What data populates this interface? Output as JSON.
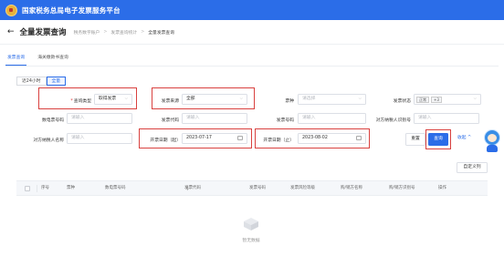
{
  "app": {
    "title": "国家税务总局电子发票服务平台"
  },
  "header": {
    "back_symbol": "←",
    "title": "全量发票查询",
    "breadcrumb": [
      "税务数字账户",
      "发票查询统计",
      "全量发票查询"
    ]
  },
  "tabs": [
    {
      "label": "发票查询",
      "active": true
    },
    {
      "label": "海关缴款书查询",
      "active": false
    }
  ],
  "quick_filters": [
    {
      "label": "近24小时",
      "active": false
    },
    {
      "label": "全量",
      "active": true
    }
  ],
  "filters": {
    "query_type": {
      "label": "查询类型",
      "required": true,
      "value": "取得发票"
    },
    "invoice_source": {
      "label": "发票来源",
      "value": "全部"
    },
    "ticket_type": {
      "label": "票种",
      "placeholder": "请选择"
    },
    "invoice_status": {
      "label": "发票状态",
      "tag": "正常",
      "more": "+3"
    },
    "digital_no": {
      "label": "数电票号码",
      "placeholder": "请输入"
    },
    "invoice_code": {
      "label": "发票代码",
      "placeholder": "请输入"
    },
    "invoice_no": {
      "label": "发票号码",
      "placeholder": "请输入"
    },
    "counter_tax_id": {
      "label": "对方纳税人识别号",
      "placeholder": "请输入"
    },
    "counter_name": {
      "label": "对方纳税人名称",
      "placeholder": "请输入"
    },
    "date_start": {
      "label": "开票日期（起）",
      "value": "2023-07-17"
    },
    "date_end": {
      "label": "开票日期（止）",
      "value": "2023-08-02"
    }
  },
  "actions": {
    "reset": "重置",
    "query": "查询",
    "collapse": "收起 ^",
    "custom_columns": "自定义列"
  },
  "table": {
    "columns": [
      "序号",
      "票种",
      "数电票号码",
      "发票代码",
      "发票号码",
      "发票风险等级",
      "购/销方名称",
      "购/销方识别号",
      "操作"
    ]
  },
  "empty": {
    "text": "暂无数据"
  },
  "colors": {
    "brand": "#2b6de8",
    "highlight": "#d9413f"
  }
}
